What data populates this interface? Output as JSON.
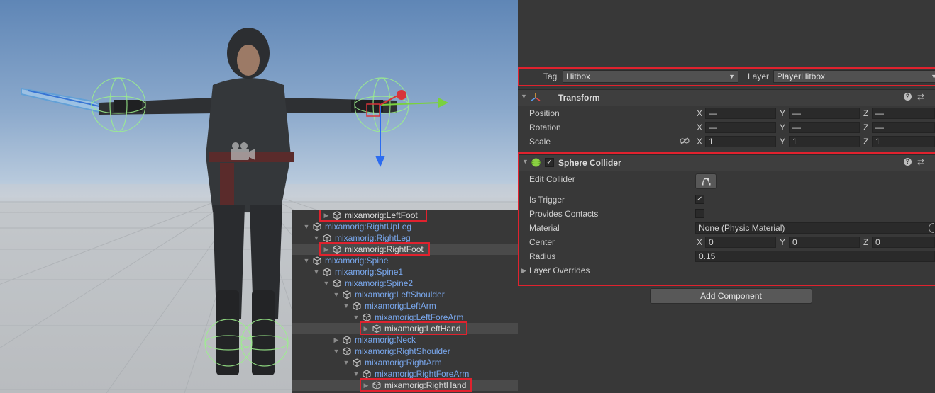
{
  "hierarchy": {
    "items": [
      {
        "label": "mixamorig:LeftFoot"
      },
      {
        "label": "mixamorig:RightUpLeg"
      },
      {
        "label": "mixamorig:RightLeg"
      },
      {
        "label": "mixamorig:RightFoot"
      },
      {
        "label": "mixamorig:Spine"
      },
      {
        "label": "mixamorig:Spine1"
      },
      {
        "label": "mixamorig:Spine2"
      },
      {
        "label": "mixamorig:LeftShoulder"
      },
      {
        "label": "mixamorig:LeftArm"
      },
      {
        "label": "mixamorig:LeftForeArm"
      },
      {
        "label": "mixamorig:LeftHand"
      },
      {
        "label": "mixamorig:Neck"
      },
      {
        "label": "mixamorig:RightShoulder"
      },
      {
        "label": "mixamorig:RightArm"
      },
      {
        "label": "mixamorig:RightForeArm"
      },
      {
        "label": "mixamorig:RightHand"
      }
    ]
  },
  "inspector": {
    "tag_label": "Tag",
    "tag_value": "Hitbox",
    "layer_label": "Layer",
    "layer_value": "PlayerHitbox",
    "transform": {
      "title": "Transform",
      "position_label": "Position",
      "rotation_label": "Rotation",
      "scale_label": "Scale",
      "x": "X",
      "y": "Y",
      "z": "Z",
      "position": {
        "x": "—",
        "y": "—",
        "z": "—"
      },
      "rotation": {
        "x": "—",
        "y": "—",
        "z": "—"
      },
      "scale": {
        "x": "1",
        "y": "1",
        "z": "1"
      }
    },
    "sphere_collider": {
      "title": "Sphere Collider",
      "enabled": true,
      "edit_collider_label": "Edit Collider",
      "is_trigger_label": "Is Trigger",
      "is_trigger": true,
      "provides_contacts_label": "Provides Contacts",
      "provides_contacts": false,
      "material_label": "Material",
      "material_value": "None (Physic Material)",
      "center_label": "Center",
      "center": {
        "x": "0",
        "y": "0",
        "z": "0"
      },
      "radius_label": "Radius",
      "radius_value": "0.15",
      "layer_overrides_label": "Layer Overrides"
    },
    "add_component_label": "Add Component"
  },
  "colors": {
    "highlight": "#e0222e",
    "hierarchy_link": "#7aa8ee",
    "gizmo_green": "#9cf08c"
  }
}
